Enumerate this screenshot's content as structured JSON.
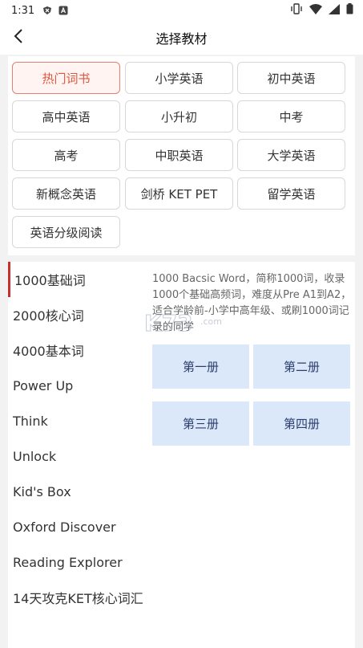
{
  "status_bar": {
    "time": "1:31",
    "icons": [
      "shield-icon",
      "a-icon",
      "vibrate-icon",
      "wifi-icon",
      "signal-icon",
      "battery-icon"
    ]
  },
  "header": {
    "title": "选择教材",
    "back_icon": "chevron-left-icon"
  },
  "categories": [
    {
      "label": "热门词书",
      "active": true
    },
    {
      "label": "小学英语",
      "active": false
    },
    {
      "label": "初中英语",
      "active": false
    },
    {
      "label": "高中英语",
      "active": false
    },
    {
      "label": "小升初",
      "active": false
    },
    {
      "label": "中考",
      "active": false
    },
    {
      "label": "高考",
      "active": false
    },
    {
      "label": "中职英语",
      "active": false
    },
    {
      "label": "大学英语",
      "active": false
    },
    {
      "label": "新概念英语",
      "active": false
    },
    {
      "label": "剑桥 KET PET",
      "active": false
    },
    {
      "label": "留学英语",
      "active": false
    },
    {
      "label": "英语分级阅读",
      "active": false
    }
  ],
  "word_lists": [
    {
      "label": "1000基础词",
      "active": true
    },
    {
      "label": "2000核心词",
      "active": false
    },
    {
      "label": "4000基本词",
      "active": false
    },
    {
      "label": "Power Up",
      "active": false
    },
    {
      "label": "Think",
      "active": false
    },
    {
      "label": "Unlock",
      "active": false
    },
    {
      "label": "Kid's Box",
      "active": false
    },
    {
      "label": "Oxford Discover",
      "active": false
    },
    {
      "label": "Reading Explorer",
      "active": false
    },
    {
      "label": "14天攻克KET核心词汇",
      "active": false
    }
  ],
  "description": "1000 Bacsic Word，简称1000词，收录1000个基础高频词，难度从Pre A1到A2，适合学龄前-小学中高年级、或刷1000词记录的同学",
  "volumes": [
    "第一册",
    "第二册",
    "第三册",
    "第四册"
  ],
  "colors": {
    "accent_red": "#e0573e",
    "active_bar": "#c9302c",
    "volume_bg": "#dbe8fa",
    "volume_text": "#2c3e6e"
  }
}
